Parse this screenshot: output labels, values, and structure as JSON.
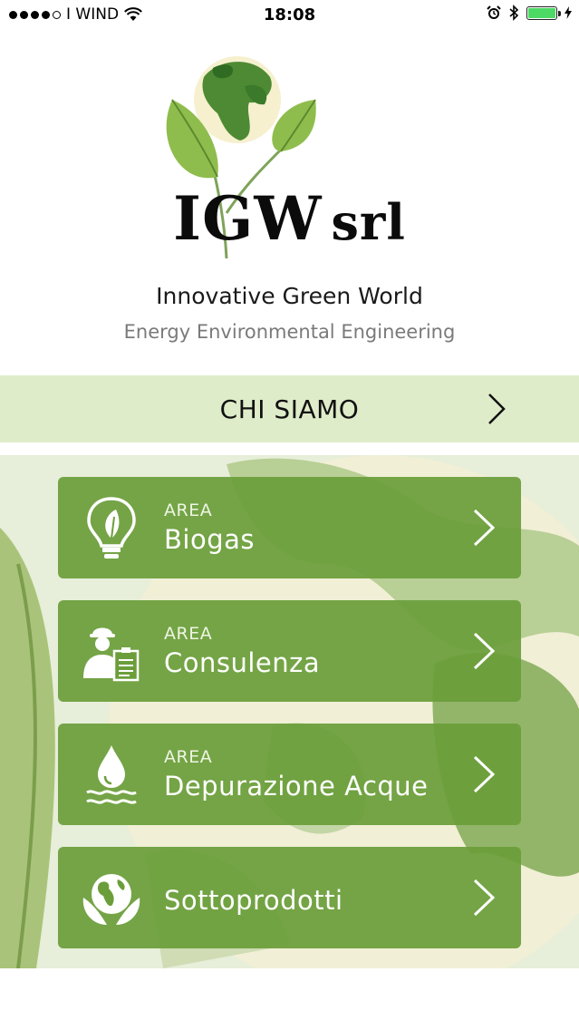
{
  "status_bar": {
    "carrier": "WIND",
    "time": "18:08",
    "battery_color": "#4cd964"
  },
  "header": {
    "logo_main": "IGW",
    "logo_suffix": "srl",
    "tagline": "Innovative Green World",
    "subtagline": "Energy Environmental Engineering"
  },
  "chi_siamo": {
    "label": "CHI SIAMO",
    "bar_color": "#dfecc9"
  },
  "menu": [
    {
      "area": "AREA",
      "title": "Biogas",
      "icon": "lightbulb-leaf-icon"
    },
    {
      "area": "AREA",
      "title": "Consulenza",
      "icon": "worker-clipboard-icon"
    },
    {
      "area": "AREA",
      "title": "Depurazione Acque",
      "icon": "water-drop-icon"
    },
    {
      "area": "",
      "title": "Sottoprodotti",
      "icon": "globe-leaves-icon"
    }
  ],
  "accent_color": "#6b9e3a"
}
